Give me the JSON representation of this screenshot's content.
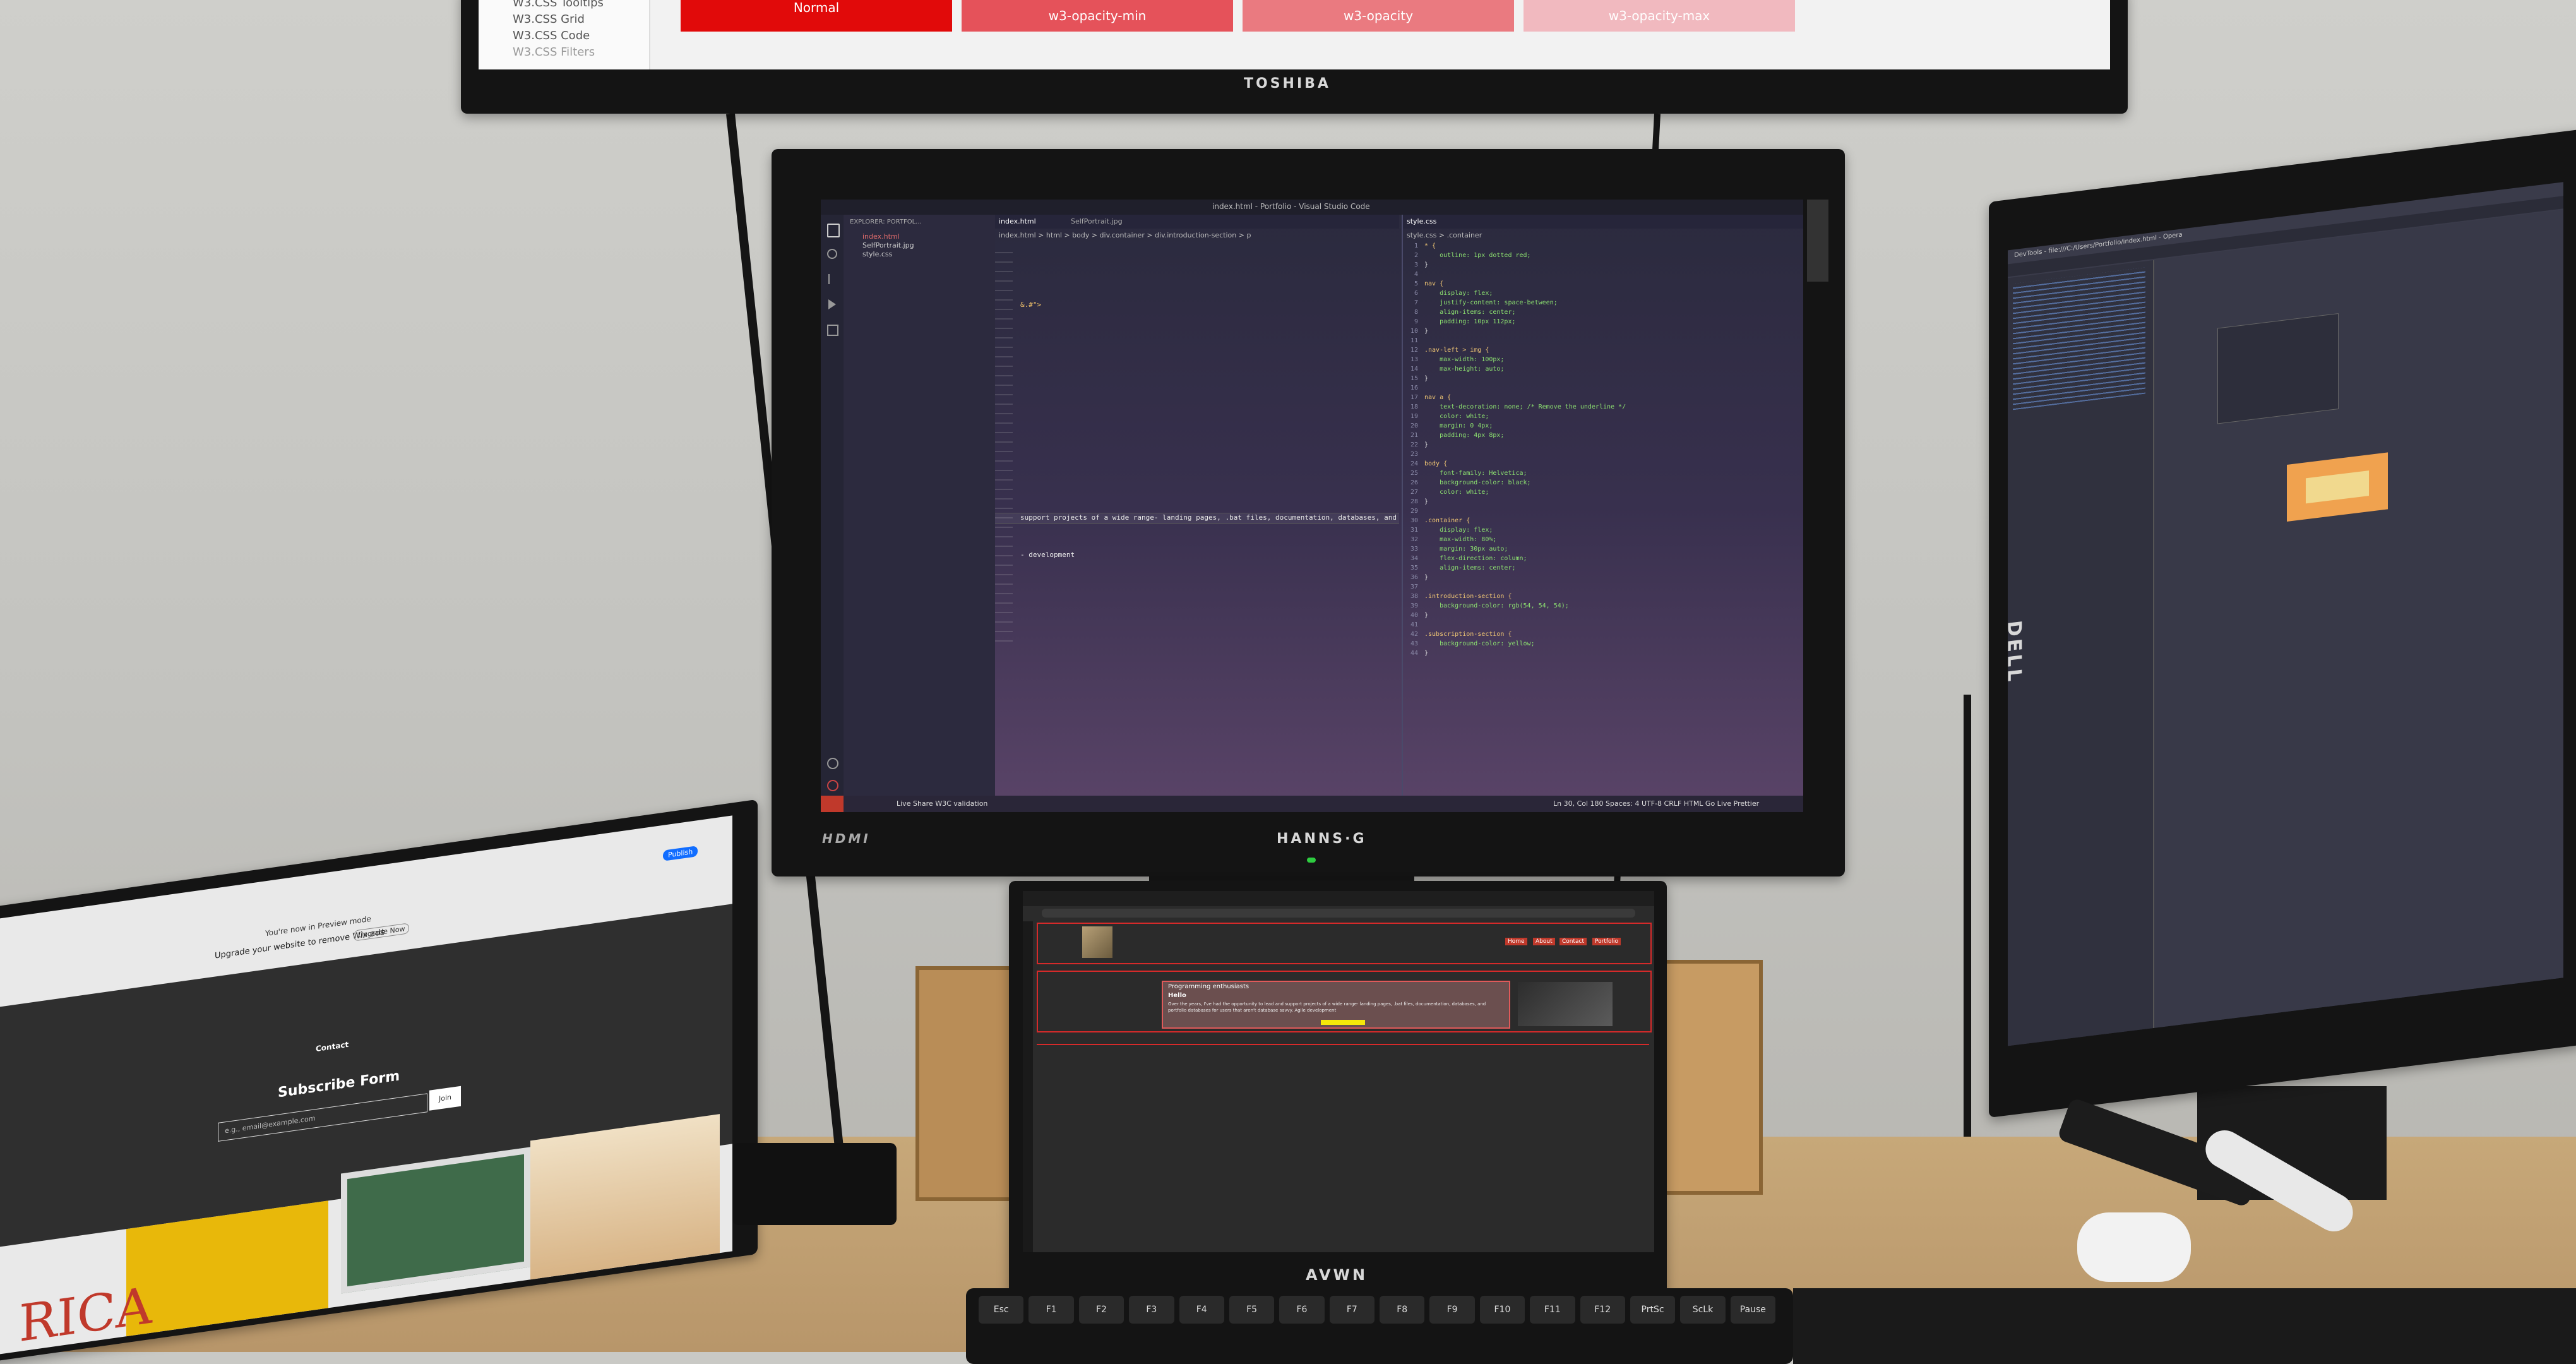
{
  "top_monitor": {
    "brand": "TOSHIBA",
    "sidebar_items": [
      "W3.CSS Tooltips",
      "W3.CSS Grid",
      "W3.CSS Code",
      "W3.CSS Filters"
    ],
    "swatches": [
      {
        "label": "Normal",
        "color": "#e10a0a"
      },
      {
        "label": "w3-opacity-min",
        "color": "#e85a5a"
      },
      {
        "label": "w3-opacity",
        "color": "#ea7a7a"
      },
      {
        "label": "w3-opacity-max",
        "color": "#f1b5b5"
      }
    ]
  },
  "center_monitor": {
    "brand": "HANNS·G",
    "port_label": "HDMI",
    "window_title": "index.html - Portfolio - Visual Studio Code",
    "explorer_header": "EXPLORER: PORTFOL...",
    "files": [
      "index.html",
      "SelfPortrait.jpg",
      "style.css"
    ],
    "tabs_left": [
      "index.html",
      "SelfPortrait.jpg"
    ],
    "tab_right": "style.css",
    "breadcrumb_left": "index.html > html > body > div.container > div.introduction-section > p",
    "breadcrumb_right": "style.css > .container",
    "left_code": [
      {
        "n": "1",
        "t": ""
      },
      {
        "n": "2",
        "t": ""
      },
      {
        "n": "3",
        "t": "&.#\">"
      },
      {
        "n": "30",
        "t": "support projects of a wide range- landing pages, .bat files, documentation, databases, and port"
      },
      {
        "n": "31",
        "t": ""
      },
      {
        "n": "32",
        "t": ""
      },
      {
        "n": "33",
        "t": "- development"
      }
    ],
    "right_code": [
      {
        "n": "1",
        "t": "* {"
      },
      {
        "n": "2",
        "t": "    outline: 1px dotted red;"
      },
      {
        "n": "3",
        "t": "}"
      },
      {
        "n": "4",
        "t": ""
      },
      {
        "n": "5",
        "t": "nav {"
      },
      {
        "n": "6",
        "t": "    display: flex;"
      },
      {
        "n": "7",
        "t": "    justify-content: space-between;"
      },
      {
        "n": "8",
        "t": "    align-items: center;"
      },
      {
        "n": "9",
        "t": "    padding: 10px 112px;"
      },
      {
        "n": "10",
        "t": "}"
      },
      {
        "n": "11",
        "t": ""
      },
      {
        "n": "12",
        "t": ".nav-left > img {"
      },
      {
        "n": "13",
        "t": "    max-width: 100px;"
      },
      {
        "n": "14",
        "t": "    max-height: auto;"
      },
      {
        "n": "15",
        "t": "}"
      },
      {
        "n": "16",
        "t": ""
      },
      {
        "n": "17",
        "t": "nav a {"
      },
      {
        "n": "18",
        "t": "    text-decoration: none; /* Remove the underline */"
      },
      {
        "n": "19",
        "t": "    color: white;"
      },
      {
        "n": "20",
        "t": "    margin: 0 4px;"
      },
      {
        "n": "21",
        "t": "    padding: 4px 8px;"
      },
      {
        "n": "22",
        "t": "}"
      },
      {
        "n": "23",
        "t": ""
      },
      {
        "n": "24",
        "t": "body {"
      },
      {
        "n": "25",
        "t": "    font-family: Helvetica;"
      },
      {
        "n": "26",
        "t": "    background-color: black;"
      },
      {
        "n": "27",
        "t": "    color: white;"
      },
      {
        "n": "28",
        "t": "}"
      },
      {
        "n": "29",
        "t": ""
      },
      {
        "n": "30",
        "t": ".container {"
      },
      {
        "n": "31",
        "t": "    display: flex;"
      },
      {
        "n": "32",
        "t": "    max-width: 80%;"
      },
      {
        "n": "33",
        "t": "    margin: 30px auto;"
      },
      {
        "n": "34",
        "t": "    flex-direction: column;"
      },
      {
        "n": "35",
        "t": "    align-items: center;"
      },
      {
        "n": "36",
        "t": "}"
      },
      {
        "n": "37",
        "t": ""
      },
      {
        "n": "38",
        "t": ".introduction-section {"
      },
      {
        "n": "39",
        "t": "    background-color: rgb(54, 54, 54);"
      },
      {
        "n": "40",
        "t": "}"
      },
      {
        "n": "41",
        "t": ""
      },
      {
        "n": "42",
        "t": ".subscription-section {"
      },
      {
        "n": "43",
        "t": "    background-color: yellow;"
      },
      {
        "n": "44",
        "t": "}"
      }
    ],
    "status_left": "Live Share  W3C validation",
    "status_right": "Ln 30, Col 180  Spaces: 4  UTF-8  CRLF  HTML  Go Live  Prettier"
  },
  "bottom_monitor": {
    "brand": "AVWN",
    "nav_links": [
      "Home",
      "About",
      "Contact",
      "Portfolio"
    ],
    "heading": "Programming enthusiasts",
    "hello": "Hello",
    "body_text": "Over the years, I've had the opportunity to lead and support projects of a wide range- landing pages, .bat files, documentation, databases, and portfolio databases for users that aren't database savvy. Agile development"
  },
  "left_laptop": {
    "banner": "You're now in Preview mode",
    "upgrade_text": "Upgrade your website to remove Wix ads",
    "upgrade_button": "Upgrade Now",
    "publish_button": "Publish",
    "section_link": "Contact",
    "form_title": "Subscribe Form",
    "email_placeholder": "e.g., email@example.com",
    "join_button": "Join",
    "bottom_text": "RICA"
  },
  "right_monitor": {
    "brand": "DELL",
    "window_title": "DevTools - file:///C:/Users/Portfolio/index.html - Opera"
  },
  "keyboard": {
    "keys": [
      "Esc",
      "F1",
      "F2",
      "F3",
      "F4",
      "F5",
      "F6",
      "F7",
      "F8",
      "F9",
      "F10",
      "F11",
      "F12",
      "PrtSc",
      "ScLk",
      "Pause"
    ]
  }
}
